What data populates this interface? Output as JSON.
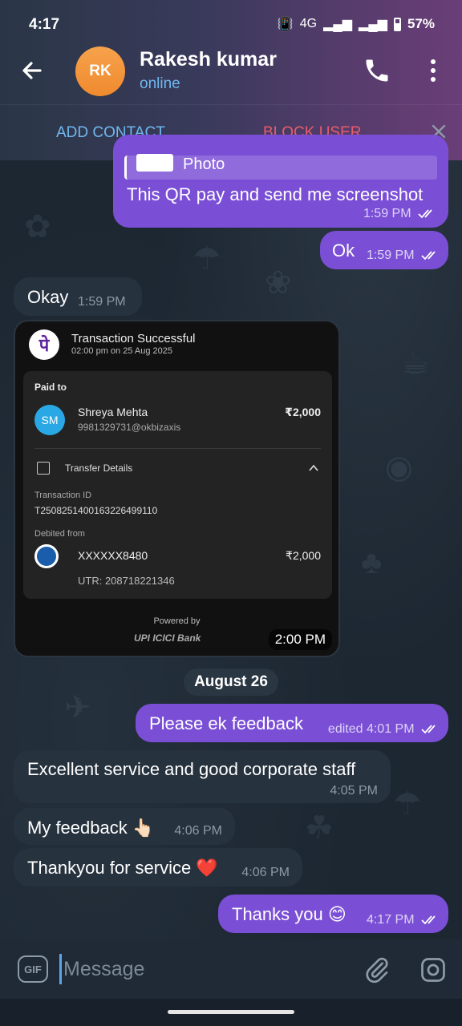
{
  "status_bar": {
    "time": "4:17",
    "network": "4G",
    "battery": "57%"
  },
  "header": {
    "avatar_initials": "RK",
    "contact_name": "Rakesh kumar",
    "contact_status": "online"
  },
  "action_bar": {
    "add_contact": "ADD CONTACT",
    "block_user": "BLOCK USER"
  },
  "messages": [
    {
      "direction": "out",
      "reply_label": "Photo",
      "text": "This QR pay and send me screenshot",
      "time": "1:59 PM",
      "read": true
    },
    {
      "direction": "out",
      "text": "Ok",
      "time": "1:59 PM",
      "read": true
    },
    {
      "direction": "in",
      "text": "Okay",
      "time": "1:59 PM"
    },
    {
      "direction": "in",
      "type": "image",
      "time": "2:00 PM"
    },
    {
      "direction": "out",
      "text": "Please ek feedback",
      "time": "edited 4:01 PM",
      "read": true
    },
    {
      "direction": "in",
      "text": "Excellent service and good corporate staff",
      "time": "4:05 PM"
    },
    {
      "direction": "in",
      "text": "My feedback 👆🏻",
      "time": "4:06 PM"
    },
    {
      "direction": "in",
      "text": "Thankyou for service ❤️",
      "time": "4:06 PM"
    },
    {
      "direction": "out",
      "text": "Thanks you 😊",
      "time": "4:17 PM",
      "read": true
    }
  ],
  "date_separator": "August 26",
  "payment_screenshot": {
    "logo": "पे",
    "title": "Transaction Successful",
    "subtitle": "02:00 pm on 25 Aug 2025",
    "paid_to_label": "Paid to",
    "payee_initials": "SM",
    "payee_name": "Shreya Mehta",
    "payee_upi": "9981329731@okbizaxis",
    "amount": "₹2,000",
    "transfer_details_label": "Transfer Details",
    "transaction_id_label": "Transaction ID",
    "transaction_id": "T2508251400163226499110",
    "debited_from_label": "Debited from",
    "account": "XXXXXX8480",
    "debit_amount": "₹2,000",
    "utr": "UTR: 208718221346",
    "powered_by": "Powered by",
    "brand": "UPI ICICI Bank"
  },
  "input": {
    "gif_label": "GIF",
    "placeholder": "Message"
  },
  "colors": {
    "outgoing_bubble": "#7a4fd6",
    "incoming_bubble": "#26323e",
    "accent_blue": "#6fb8f0",
    "danger_red": "#e65d6b",
    "avatar_orange": "#f39a3c"
  }
}
